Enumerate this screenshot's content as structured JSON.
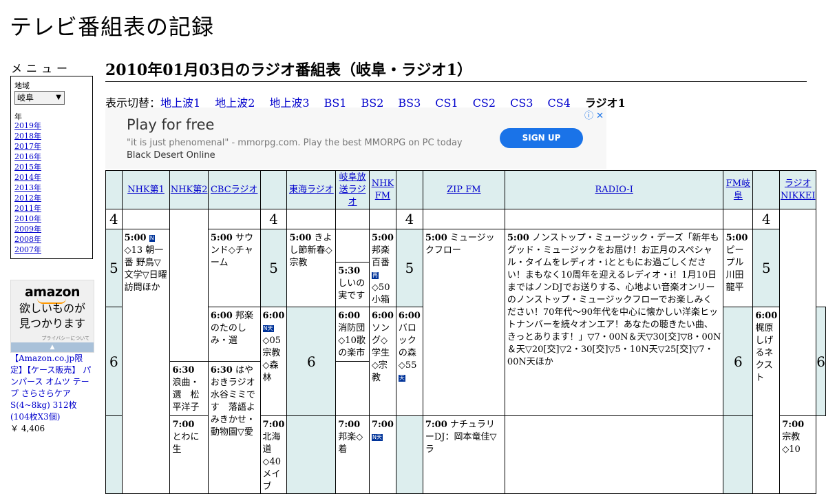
{
  "site": {
    "title": "テレビ番組表の記録"
  },
  "menu": {
    "title": "メニュー",
    "region_label": "地域",
    "region_value": "岐阜",
    "year_label": "年",
    "years": [
      "2019年",
      "2018年",
      "2017年",
      "2016年",
      "2015年",
      "2014年",
      "2013年",
      "2012年",
      "2011年",
      "2010年",
      "2009年",
      "2008年",
      "2007年"
    ]
  },
  "amazon_ad": {
    "logo": "amazon",
    "copy_line1": "欲しいものが",
    "copy_line2": "見つかります",
    "privacy": "プライバシーについて",
    "product_text": "【Amazon.co.jp限定】【ケース販売】 パンパース オムツ テープ さらさらケア S(4~8kg) 312枚(104枚X3個)",
    "price": "￥ 4,406"
  },
  "page": {
    "heading": "2010年01月03日のラジオ番組表（岐阜・ラジオ1）"
  },
  "switcher": {
    "label": "表示切替：",
    "links": [
      "地上波1",
      "地上波2",
      "地上波3",
      "BS1",
      "BS2",
      "BS3",
      "CS1",
      "CS2",
      "CS3",
      "CS4"
    ],
    "current": "ラジオ1"
  },
  "ad": {
    "title": "Play for free",
    "description": "\"it is just phenomenal\" - mmorpg.com. Play the best MMORPG on PC today ",
    "description_brand": "Black Desert Online",
    "button": "SIGN UP",
    "info_icons": "ⓘ ✕"
  },
  "schedule": {
    "channels": [
      "NHK第1",
      "NHK第2",
      "CBCラジオ",
      "東海ラジオ",
      "岐阜放送ラジオ",
      "NHK FM",
      "ZIP FM",
      "RADIO-I",
      "FM岐阜",
      "ラジオNIKKEI"
    ],
    "hours": [
      "4",
      "5",
      "6"
    ],
    "programs": {
      "nhk1_500": {
        "time": "5:00",
        "mark": "N",
        "text": "◇13 朝一番 野鳥▽文学▽日曜訪問ほか"
      },
      "nhk2_600": {
        "time": "6:00",
        "text": "邦楽のたのしみ・選"
      },
      "nhk2_630": {
        "time": "6:30",
        "text": "浪曲・選　松平洋子"
      },
      "nhk2_700": {
        "time": "7:00",
        "text": "とわに生"
      },
      "cbc_500": {
        "time": "5:00",
        "text": "サウンド◇チャーム"
      },
      "cbc_600": {
        "time": "6:00",
        "mark": "N天",
        "text": "◇05宗教◇森林"
      },
      "cbc_700": {
        "time": "7:00",
        "text": "北海道◇40メイブ"
      },
      "tokai_500": {
        "time": "5:00",
        "text": "きよし節新春◇宗教"
      },
      "tokai_600": {
        "time": "6:00",
        "text": "消防団◇10歌の楽市"
      },
      "tokai_630": {
        "time": "6:30",
        "text": "はやおきラジオ水谷ミミです　落語よみきかせ・動物園▽愛"
      },
      "gifu_530": {
        "time": "5:30",
        "text": "しいの実です"
      },
      "gifu_600": {
        "time": "6:00",
        "text": "ソング◇学生◇宗教"
      },
      "gifu_700": {
        "time": "7:00",
        "text": "邦楽◇着"
      },
      "nhkfm_500": {
        "time": "5:00",
        "text": "邦楽百番",
        "mark": "再",
        "text2": "◇50 小箱"
      },
      "nhkfm_600": {
        "time": "6:00",
        "text": "バロックの森◇55",
        "mark": "天"
      },
      "nhkfm_700": {
        "time": "7:00",
        "mark": "N天"
      },
      "zip_500": {
        "time": "5:00",
        "text": "ミュージックフロー"
      },
      "zip_700": {
        "time": "7:00",
        "text": "ナチュラリーDJ：岡本竜佳▽ラ"
      },
      "radioi_500": {
        "time": "5:00",
        "text": "ノンストップ・ミュージック・デーズ「新年もグッド・ミュージックをお届け！お正月のスペシャル・タイムをレディオ・iとともにお過ごしください！まもなく10周年を迎えるレディオ・i！1月10日まではノンDJでお送りする、心地よい音楽オンリーのノンストップ・ミュージックフローでお楽しみください！70年代～90年代を中心に懐かしい洋楽ヒットナンバーを続々オンエア！あなたの聴きたい曲、きっとあります！」▽7・00N＆天▽30[交]▽8・00N＆天▽20[交]▽2・30[交]▽5・10N天▽25[交]▽7・00N天ほか"
      },
      "fmgifu_500": {
        "time": "5:00",
        "text": "ピープル 川田龍平"
      },
      "fmgifu_600": {
        "time": "6:00",
        "text": "梶原しげるネクスト"
      },
      "nikkei_700": {
        "time": "7:00",
        "text": "宗教◇10"
      }
    }
  }
}
